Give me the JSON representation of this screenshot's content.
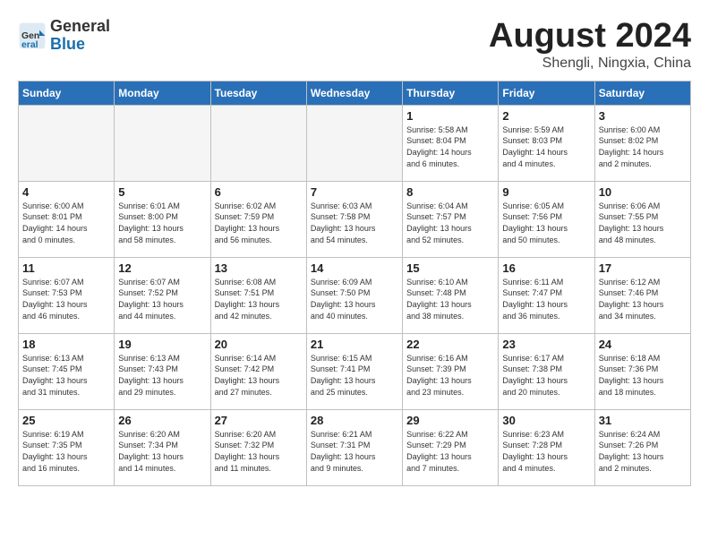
{
  "header": {
    "logo_general": "General",
    "logo_blue": "Blue",
    "month_year": "August 2024",
    "location": "Shengli, Ningxia, China"
  },
  "weekdays": [
    "Sunday",
    "Monday",
    "Tuesday",
    "Wednesday",
    "Thursday",
    "Friday",
    "Saturday"
  ],
  "weeks": [
    [
      {
        "day": "",
        "info": ""
      },
      {
        "day": "",
        "info": ""
      },
      {
        "day": "",
        "info": ""
      },
      {
        "day": "",
        "info": ""
      },
      {
        "day": "1",
        "info": "Sunrise: 5:58 AM\nSunset: 8:04 PM\nDaylight: 14 hours\nand 6 minutes."
      },
      {
        "day": "2",
        "info": "Sunrise: 5:59 AM\nSunset: 8:03 PM\nDaylight: 14 hours\nand 4 minutes."
      },
      {
        "day": "3",
        "info": "Sunrise: 6:00 AM\nSunset: 8:02 PM\nDaylight: 14 hours\nand 2 minutes."
      }
    ],
    [
      {
        "day": "4",
        "info": "Sunrise: 6:00 AM\nSunset: 8:01 PM\nDaylight: 14 hours\nand 0 minutes."
      },
      {
        "day": "5",
        "info": "Sunrise: 6:01 AM\nSunset: 8:00 PM\nDaylight: 13 hours\nand 58 minutes."
      },
      {
        "day": "6",
        "info": "Sunrise: 6:02 AM\nSunset: 7:59 PM\nDaylight: 13 hours\nand 56 minutes."
      },
      {
        "day": "7",
        "info": "Sunrise: 6:03 AM\nSunset: 7:58 PM\nDaylight: 13 hours\nand 54 minutes."
      },
      {
        "day": "8",
        "info": "Sunrise: 6:04 AM\nSunset: 7:57 PM\nDaylight: 13 hours\nand 52 minutes."
      },
      {
        "day": "9",
        "info": "Sunrise: 6:05 AM\nSunset: 7:56 PM\nDaylight: 13 hours\nand 50 minutes."
      },
      {
        "day": "10",
        "info": "Sunrise: 6:06 AM\nSunset: 7:55 PM\nDaylight: 13 hours\nand 48 minutes."
      }
    ],
    [
      {
        "day": "11",
        "info": "Sunrise: 6:07 AM\nSunset: 7:53 PM\nDaylight: 13 hours\nand 46 minutes."
      },
      {
        "day": "12",
        "info": "Sunrise: 6:07 AM\nSunset: 7:52 PM\nDaylight: 13 hours\nand 44 minutes."
      },
      {
        "day": "13",
        "info": "Sunrise: 6:08 AM\nSunset: 7:51 PM\nDaylight: 13 hours\nand 42 minutes."
      },
      {
        "day": "14",
        "info": "Sunrise: 6:09 AM\nSunset: 7:50 PM\nDaylight: 13 hours\nand 40 minutes."
      },
      {
        "day": "15",
        "info": "Sunrise: 6:10 AM\nSunset: 7:48 PM\nDaylight: 13 hours\nand 38 minutes."
      },
      {
        "day": "16",
        "info": "Sunrise: 6:11 AM\nSunset: 7:47 PM\nDaylight: 13 hours\nand 36 minutes."
      },
      {
        "day": "17",
        "info": "Sunrise: 6:12 AM\nSunset: 7:46 PM\nDaylight: 13 hours\nand 34 minutes."
      }
    ],
    [
      {
        "day": "18",
        "info": "Sunrise: 6:13 AM\nSunset: 7:45 PM\nDaylight: 13 hours\nand 31 minutes."
      },
      {
        "day": "19",
        "info": "Sunrise: 6:13 AM\nSunset: 7:43 PM\nDaylight: 13 hours\nand 29 minutes."
      },
      {
        "day": "20",
        "info": "Sunrise: 6:14 AM\nSunset: 7:42 PM\nDaylight: 13 hours\nand 27 minutes."
      },
      {
        "day": "21",
        "info": "Sunrise: 6:15 AM\nSunset: 7:41 PM\nDaylight: 13 hours\nand 25 minutes."
      },
      {
        "day": "22",
        "info": "Sunrise: 6:16 AM\nSunset: 7:39 PM\nDaylight: 13 hours\nand 23 minutes."
      },
      {
        "day": "23",
        "info": "Sunrise: 6:17 AM\nSunset: 7:38 PM\nDaylight: 13 hours\nand 20 minutes."
      },
      {
        "day": "24",
        "info": "Sunrise: 6:18 AM\nSunset: 7:36 PM\nDaylight: 13 hours\nand 18 minutes."
      }
    ],
    [
      {
        "day": "25",
        "info": "Sunrise: 6:19 AM\nSunset: 7:35 PM\nDaylight: 13 hours\nand 16 minutes."
      },
      {
        "day": "26",
        "info": "Sunrise: 6:20 AM\nSunset: 7:34 PM\nDaylight: 13 hours\nand 14 minutes."
      },
      {
        "day": "27",
        "info": "Sunrise: 6:20 AM\nSunset: 7:32 PM\nDaylight: 13 hours\nand 11 minutes."
      },
      {
        "day": "28",
        "info": "Sunrise: 6:21 AM\nSunset: 7:31 PM\nDaylight: 13 hours\nand 9 minutes."
      },
      {
        "day": "29",
        "info": "Sunrise: 6:22 AM\nSunset: 7:29 PM\nDaylight: 13 hours\nand 7 minutes."
      },
      {
        "day": "30",
        "info": "Sunrise: 6:23 AM\nSunset: 7:28 PM\nDaylight: 13 hours\nand 4 minutes."
      },
      {
        "day": "31",
        "info": "Sunrise: 6:24 AM\nSunset: 7:26 PM\nDaylight: 13 hours\nand 2 minutes."
      }
    ]
  ]
}
